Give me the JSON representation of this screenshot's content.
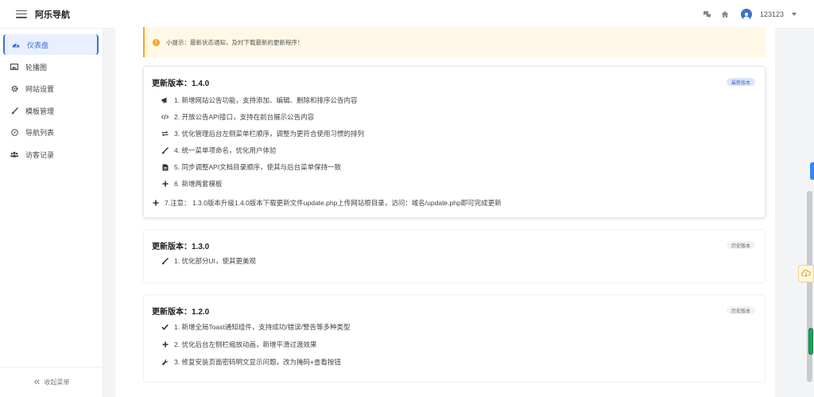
{
  "app": {
    "brand": "阿乐导航"
  },
  "header": {
    "username": "123123"
  },
  "sidebar": {
    "items": [
      {
        "label": "仪表盘",
        "icon": "dashboard-icon",
        "active": true
      },
      {
        "label": "轮播图",
        "icon": "image-icon",
        "active": false
      },
      {
        "label": "网站设置",
        "icon": "gear-icon",
        "active": false
      },
      {
        "label": "模板管理",
        "icon": "brush-icon",
        "active": false
      },
      {
        "label": "导航列表",
        "icon": "compass-icon",
        "active": false
      },
      {
        "label": "访客记录",
        "icon": "users-icon",
        "active": false
      }
    ],
    "collapse_label": "收起菜单"
  },
  "notice": {
    "text": "小提示：最新状态通知，及时下载最新的更新程序！"
  },
  "releases": [
    {
      "title": "更新版本：1.4.0",
      "badge": "最新版本",
      "items": [
        {
          "icon": "megaphone-icon",
          "text": "1. 新增网站公告功能，支持添加、编辑、删除和排序公告内容"
        },
        {
          "icon": "code-icon",
          "text": "2. 开放公告API接口，支持在前台展示公告内容"
        },
        {
          "icon": "swap-icon",
          "text": "3. 优化管理后台左侧菜单栏顺序，调整为更符合使用习惯的排列"
        },
        {
          "icon": "brush-icon",
          "text": "4. 统一菜单项命名，优化用户体验"
        },
        {
          "icon": "document-icon",
          "text": "5. 同步调整API文档目录顺序，使其与后台菜单保持一致"
        },
        {
          "icon": "plus-icon",
          "text": "6. 新增两套模板"
        }
      ],
      "note": {
        "icon": "plus-icon",
        "text": "7.注意：  1.3.0版本升级1.4.0版本下载更新文件update.php上传网站根目录，访问：域名/update.php即可完成更新"
      }
    },
    {
      "title": "更新版本：1.3.0",
      "badge": "历史版本",
      "items": [
        {
          "icon": "brush-icon",
          "text": "1. 优化部分UI，使其更美观"
        }
      ]
    },
    {
      "title": "更新版本：1.2.0",
      "badge": "历史版本",
      "items": [
        {
          "icon": "check-icon",
          "text": "1. 新增全局Toast通知组件，支持成功/错误/警告等多种类型"
        },
        {
          "icon": "plus-icon",
          "text": "2. 优化后台左侧栏缩放动画，新增平滑过渡效果"
        },
        {
          "icon": "wrench-icon",
          "text": "3. 修复安装页面密码明文显示问题，改为掩码+查看按钮"
        }
      ]
    }
  ],
  "colors": {
    "accent": "#3b6fd4",
    "warning": "#f5a623",
    "success": "#1aa55a"
  }
}
